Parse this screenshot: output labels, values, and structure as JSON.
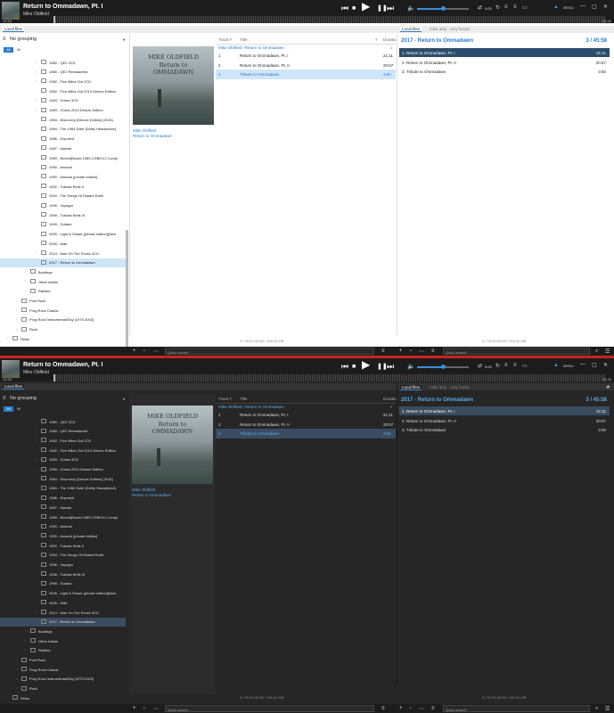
{
  "player": {
    "title": "Return to Ommadawn, Pt. I",
    "artist": "Mike Oldfield",
    "time_elapsed_light": "12:19",
    "time_elapsed_dark": "12:34",
    "time_total": "21:11",
    "prev_icon": "⏮",
    "stop_icon": "■",
    "play_icon": "▶",
    "pause_icon": "❚❚",
    "next_icon": "⏭",
    "volume_icon": "🔈",
    "volume_level": 0.5,
    "shuffle_icon": "⇄",
    "repeat_icon": "↻",
    "lyrics_icon": "≡",
    "cast_icon": "▭",
    "menu_label": "MENU",
    "minimize_icon": "—",
    "restore_icon": "▢",
    "close_icon": "✕",
    "time_small": "0:00"
  },
  "tabs": {
    "local_files": "Local files",
    "search_query": "mike amy - amy hoops"
  },
  "library": {
    "grouping": "No grouping",
    "all_tab": "All",
    "w_tab": "W",
    "tree": [
      {
        "label": "1980 - QE2 2CD",
        "level": 3,
        "exp": true,
        "sel": false
      },
      {
        "label": "1980 - QE2 Remastered",
        "level": 3,
        "exp": true,
        "sel": false
      },
      {
        "label": "1982 - Five Miles Out 2CD",
        "level": 3,
        "exp": true,
        "sel": false
      },
      {
        "label": "1982 - Five Miles Out 2013 Deluxe Edition",
        "level": 3,
        "exp": false,
        "sel": false
      },
      {
        "label": "1983 - Crises 3CD",
        "level": 3,
        "exp": true,
        "sel": false
      },
      {
        "label": "1983 - Crises 2013 Deluxe Edition",
        "level": 3,
        "exp": true,
        "sel": false
      },
      {
        "label": "1984 - Discovery [Deluxe Edition] (2016)",
        "level": 3,
        "exp": false,
        "sel": false
      },
      {
        "label": "1984 - The 1984 Suite [Dolby Headphone]",
        "level": 3,
        "exp": false,
        "sel": false
      },
      {
        "label": "1986 - Exposed",
        "level": 3,
        "exp": false,
        "sel": false
      },
      {
        "label": "1987 - Islands",
        "level": 3,
        "exp": false,
        "sel": false
      },
      {
        "label": "1989 - Boxed(Boxed 1989-CDBOX1 Compl",
        "level": 3,
        "exp": false,
        "sel": false
      },
      {
        "label": "1990 - Amarok",
        "level": 3,
        "exp": false,
        "sel": false
      },
      {
        "label": "1990 - Amarok [private edition]",
        "level": 3,
        "exp": false,
        "sel": false
      },
      {
        "label": "1992 - Tubular Bells II",
        "level": 3,
        "exp": false,
        "sel": false
      },
      {
        "label": "1994 - The Songs Of Distant Earth",
        "level": 3,
        "exp": false,
        "sel": false
      },
      {
        "label": "1996 - Voyager",
        "level": 3,
        "exp": false,
        "sel": false
      },
      {
        "label": "1998 - Tubular Bells III",
        "level": 3,
        "exp": false,
        "sel": false
      },
      {
        "label": "1999 - Guitars",
        "level": 3,
        "exp": false,
        "sel": false
      },
      {
        "label": "2005 - Light & Shade [private edition](New",
        "level": 3,
        "exp": false,
        "sel": false
      },
      {
        "label": "2005 - Wait",
        "level": 3,
        "exp": false,
        "sel": false
      },
      {
        "label": "2014 - Man On The Rocks 3CD",
        "level": 3,
        "exp": true,
        "sel": false
      },
      {
        "label": "2017 - Return to Ommadawn",
        "level": 3,
        "exp": false,
        "sel": true
      },
      {
        "label": "Bootlegs",
        "level": 2,
        "exp": true,
        "sel": false
      },
      {
        "label": "Other Artists",
        "level": 2,
        "exp": true,
        "sel": false
      },
      {
        "label": "Rarities",
        "level": 2,
        "exp": true,
        "sel": false
      },
      {
        "label": "Post Rock",
        "level": 1,
        "exp": true,
        "sel": false
      },
      {
        "label": "Prog Rock Classic",
        "level": 1,
        "exp": true,
        "sel": false
      },
      {
        "label": "Prog Rock Instrumental\\Sky [1979-2002]",
        "level": 1,
        "exp": true,
        "sel": false
      },
      {
        "label": "Rock",
        "level": 1,
        "exp": true,
        "sel": false
      },
      {
        "label": "Relax",
        "level": 0,
        "exp": true,
        "sel": false
      }
    ]
  },
  "album": {
    "art_line1": "MIKE OLDFIELD",
    "art_line2": "Return to",
    "art_line3": "OMMADAWN",
    "artist": "Mike Oldfield",
    "title": "Return to Ommadawn"
  },
  "tracks": {
    "col_track": "Track #",
    "col_title": "Title",
    "col_q": "?",
    "col_duration": "Duratio",
    "group": "Mike Oldfield / Return to Ommadawn",
    "group_count": "4",
    "rows": [
      {
        "num": "1",
        "title": "Return to Ommadawn, Pt. I",
        "dur": "21:11",
        "playing": false
      },
      {
        "num": "2",
        "title": "Return to Ommadawn, Pt. II",
        "dur": "20:57",
        "playing": false
      },
      {
        "num": "3",
        "title": "Tribute to Ommadawn",
        "dur": "3:50",
        "playing": true
      }
    ]
  },
  "playlist": {
    "header": "2017 - Return to Ommadawn",
    "summary": "3 / 45:58",
    "star_icon": "★",
    "rows": [
      {
        "label": "1. Return to Ommadawn, Pt. I",
        "dur": "21:11",
        "active": true
      },
      {
        "label": "2. Return to Ommadawn, Pt. II",
        "dur": "20:57",
        "active": false
      },
      {
        "label": "3. Tribute to Ommadawn",
        "dur": "3:50",
        "active": false
      }
    ]
  },
  "status": {
    "center": "3 / 00:00:45:58 / 105.42 MB",
    "right": "3 / 00:00:45:58 / 105.42 MB"
  },
  "bottom": {
    "add_icon": "+",
    "remove_icon": "−",
    "more_icon": "⋯",
    "quick_search": "Quick search",
    "list_icon": "≡",
    "search_icon": "⌕",
    "hamburger_icon": "☰"
  }
}
